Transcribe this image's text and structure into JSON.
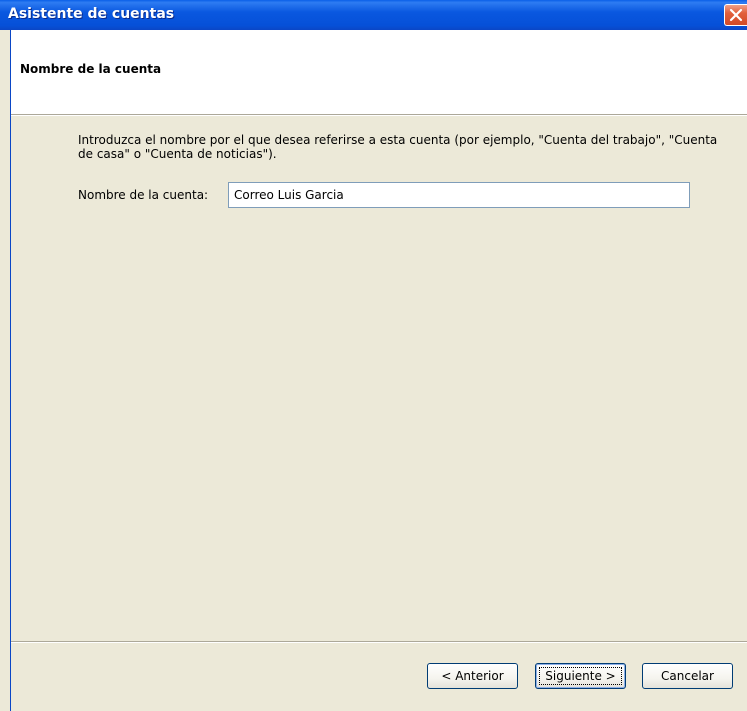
{
  "window": {
    "title": "Asistente de cuentas",
    "close_icon": "close-icon"
  },
  "header": {
    "title": "Nombre de la cuenta"
  },
  "main": {
    "instructions": "Introduzca el nombre por el que desea referirse a esta cuenta (por ejemplo, \"Cuenta del trabajo\", \"Cuenta de casa\" o \"Cuenta de noticias\").",
    "account_name_label": "Nombre de la cuenta:",
    "account_name_value": "Correo Luis Garcia"
  },
  "footer": {
    "back_label": "< Anterior",
    "next_label": "Siguiente >",
    "cancel_label": "Cancelar"
  },
  "colors": {
    "titlebar": "#0a58e0",
    "close_button": "#e2603c",
    "window_background": "#ece9d8",
    "header_background": "#ffffff"
  }
}
